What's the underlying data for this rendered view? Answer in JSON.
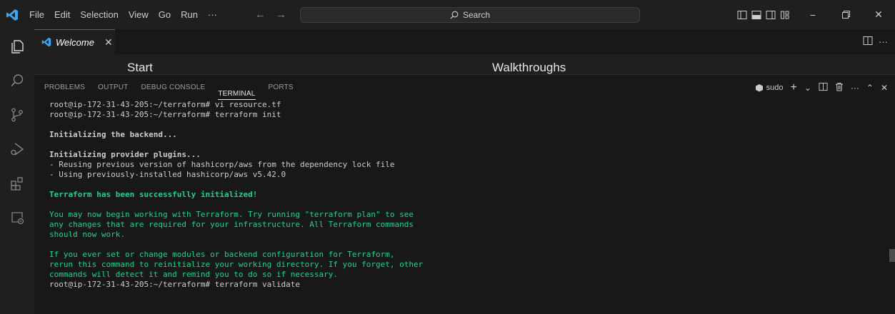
{
  "menu": [
    "File",
    "Edit",
    "Selection",
    "View",
    "Go",
    "Run",
    "···"
  ],
  "search": {
    "label": "Search"
  },
  "tab": {
    "label": "Welcome"
  },
  "welcome": {
    "start": "Start",
    "walkthroughs": "Walkthroughs"
  },
  "panel": {
    "tabs": [
      "PROBLEMS",
      "OUTPUT",
      "DEBUG CONSOLE",
      "TERMINAL",
      "PORTS"
    ],
    "active_tab": "TERMINAL",
    "terminal_name": "sudo"
  },
  "terminal": {
    "lines": [
      "root@ip-172-31-43-205:~/terraform# vi resource.tf",
      "root@ip-172-31-43-205:~/terraform# terraform init",
      "",
      "Initializing the backend...",
      "",
      "Initializing provider plugins...",
      "- Reusing previous version of hashicorp/aws from the dependency lock file",
      "- Using previously-installed hashicorp/aws v5.42.0",
      "",
      "Terraform has been successfully initialized!",
      "",
      "You may now begin working with Terraform. Try running \"terraform plan\" to see",
      "any changes that are required for your infrastructure. All Terraform commands",
      "should now work.",
      "",
      "If you ever set or change modules or backend configuration for Terraform,",
      "rerun this command to reinitialize your working directory. If you forget, other",
      "commands will detect it and remind you to do so if necessary.",
      "root@ip-172-31-43-205:~/terraform# terraform validate"
    ],
    "styles": [
      "",
      "",
      "",
      "bold",
      "",
      "bold",
      "",
      "",
      "",
      "bold green",
      "",
      "green",
      "green",
      "green",
      "",
      "green",
      "green",
      "green",
      ""
    ]
  },
  "colors": {
    "accent": "#0078d4",
    "terminal_green": "#23d18b",
    "vscode_blue": "#3ea6f0"
  },
  "icons": {
    "activity": [
      "explorer-icon",
      "search-icon",
      "source-control-icon",
      "run-debug-icon",
      "extensions-icon",
      "remote-explorer-icon"
    ]
  }
}
